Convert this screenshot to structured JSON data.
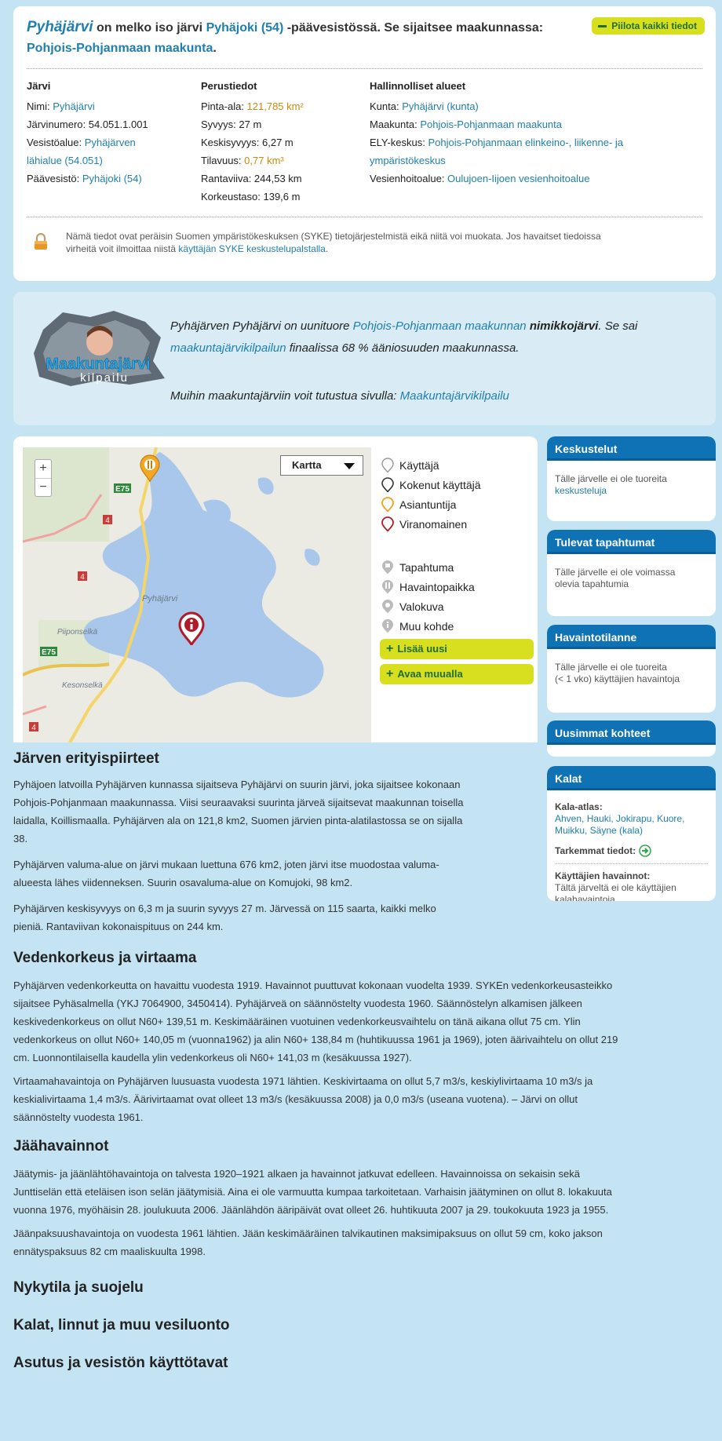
{
  "intro": {
    "lake_name": "Pyhäjärvi",
    "t1": "on melko iso järvi",
    "watershed_link": "Pyhäjoki (54)",
    "t2": "-päävesistössä. Se sijaitsee maakunnassa:",
    "region_link": "Pohjois-Pohjanmaan maakunta",
    "t3": ".",
    "hide_all_label": "Piilota kaikki tiedot"
  },
  "info": {
    "col1": {
      "title": "Järvi",
      "name_label": "Nimi:",
      "name_value": "Pyhäjärvi",
      "number_text": "Järvinumero: 54.051.1.001",
      "area_label": "Vesistöalue:",
      "area_value_1": "Pyhäjärven",
      "area_value_2": "lähialue (54.051)",
      "main_label": "Päävesistö:",
      "main_value": "Pyhäjoki (54)"
    },
    "col2": {
      "title": "Perustiedot",
      "area_label": "Pinta-ala:",
      "area_value": "121,785 km²",
      "depth_text": "Syvyys: 27 m",
      "avgdepth_text": "Keskisyvyys: 6,27 m",
      "volume_label": "Tilavuus:",
      "volume_value": "0,77 km³",
      "shore_text": "Rantaviiva: 244,53 km",
      "height_text": "Korkeustaso: 139,6 m"
    },
    "col3": {
      "title": "Hallinnolliset alueet",
      "kunta_label": "Kunta:",
      "kunta_value": "Pyhäjärvi (kunta)",
      "maakunta_label": "Maakunta:",
      "maakunta_value": "Pohjois-Pohjanmaan maakunta",
      "ely_label": "ELY-keskus:",
      "ely_value_1": "Pohjois-Pohjanmaan elinkeino-, liikenne- ja",
      "ely_value_2": "ympäristökeskus",
      "vh_label": "Vesienhoitoalue:",
      "vh_value": "Oulujoen-Iijoen vesienhoitoalue"
    },
    "notice_1": "Nämä tiedot ovat peräisin Suomen ympäristökeskuksen (SYKE) tietojärjestelmistä eikä niitä voi muokata. Jos havaitset tiedoissa",
    "notice_2": "virheitä voit ilmoittaa niistä",
    "notice_link": "käyttäjän SYKE keskustelupalstalla",
    "notice_end": "."
  },
  "maakunta": {
    "logo_text_1": "Maakuntajärvi",
    "logo_text_2": "kilpailu",
    "t1": "Pyhäjärven Pyhäjärvi on uunituore",
    "region_link": "Pohjois-Pohjanmaan maakunnan",
    "bold": "nimikkojärvi",
    "t2": ". Se sai",
    "contest_link": "maakuntajärvikilpailun",
    "t3": "finaalissa 68 % ääniosuuden maakunnassa.",
    "t4": "Muihin maakuntajärviin voit tutustua sivulla:",
    "page_link": "Maakuntajärvikilpailu"
  },
  "map": {
    "type_label": "Kartta",
    "zoom_in": "+",
    "zoom_out": "−",
    "labels": {
      "lake": "Pyhäjärvi",
      "place1": "Piiponselkä",
      "place2": "Kesonselkä",
      "e75a": "E75",
      "e75b": "E75",
      "r4a": "4",
      "r4b": "4",
      "r4c": "4"
    },
    "colors": {
      "water": "#a8c6ea",
      "land": "#eaeae2"
    },
    "legend": [
      "Käyttäjä",
      "Kokenut käyttäjä",
      "Asiantuntija",
      "Viranomainen"
    ],
    "legend2": [
      "Tapahtuma",
      "Havaintopaikka",
      "Valokuva",
      "Muu kohde"
    ],
    "add_new": "Lisää uusi",
    "open_elsewhere": "Avaa muualla"
  },
  "sidebar": {
    "keskustelut": {
      "title": "Keskustelut",
      "text": "Tälle järvelle ei ole tuoreita",
      "link": "keskusteluja"
    },
    "tapahtumat": {
      "title": "Tulevat tapahtumat",
      "text1": "Tälle järvelle ei ole voimassa",
      "text2": "olevia tapahtumia"
    },
    "havainto": {
      "title": "Havaintotilanne",
      "text1": "Tälle järvelle ei ole tuoreita",
      "text2": "(< 1 vko) käyttäjien havaintoja"
    },
    "uusimmat": {
      "title": "Uusimmat kohteet"
    },
    "kalat": {
      "title": "Kalat",
      "atlas_label": "Kala-atlas:",
      "fish_1": "Ahven, Hauki, Jokirapu, Kuore,",
      "fish_2": "Muikku, Säyne (kala)",
      "more_label": "Tarkemmat tiedot:",
      "obs_label": "Käyttäjien havainnot:",
      "obs_1": "Tältä järveltä ei ole käyttäjien",
      "obs_2": "kalahavaintoja"
    }
  },
  "sections": {
    "h1": "Järven erityispiirteet",
    "p1a": "Pyhäjoen latvoilla Pyhäjärven kunnassa sijaitseva Pyhäjärvi on suurin järvi, joka sijaitsee kokonaan",
    "p1b": "Pohjois-Pohjanmaan maakunnassa. Viisi seuraavaksi suurinta järveä sijaitsevat maakunnan toisella",
    "p1c": "laidalla, Koillismaalla. Pyhäjärven ala on 121,8 km2, Suomen järvien pinta-alatilastossa se on sijalla",
    "p1d": "38.",
    "p2a": "Pyhäjärven valuma-alue on järvi mukaan luettuna 676 km2, joten järvi itse muodostaa valuma-",
    "p2b": "alueesta lähes viidenneksen. Suurin osavaluma-alue on Komujoki, 98 km2.",
    "p3a": "Pyhäjärven keskisyvyys on 6,3 m ja suurin syvyys 27 m. Järvessä on 115 saarta, kaikki melko",
    "p3b": "pieniä. Rantaviivan kokonaispituus on 244 km.",
    "h2": "Vedenkorkeus ja virtaama",
    "p4a": "Pyhäjärven vedenkorkeutta on havaittu vuodesta 1919. Havainnot puuttuvat kokonaan vuodelta 1939. SYKEn vedenkorkeusasteikko",
    "p4b": "sijaitsee Pyhäsalmella (YKJ 7064900, 3450414). Pyhäjärveä on säännöstelty vuodesta 1960. Säännöstelyn alkamisen jälkeen",
    "p4c": "keskivedenkorkeus on ollut N60+ 139,51 m. Keskimääräinen vuotuinen vedenkorkeusvaihtelu on tänä aikana ollut 75 cm. Ylin",
    "p4d": "vedenkorkeus on ollut N60+ 140,05 m (vuonna1962) ja alin N60+ 138,84 m (huhtikuussa 1961 ja 1969), joten äärivaihtelu on ollut 219",
    "p4e": "cm. Luonnontilaisella kaudella ylin vedenkorkeus oli N60+ 141,03 m (kesäkuussa 1927).",
    "p5a": "Virtaamahavaintoja on Pyhäjärven luusuasta vuodesta 1971 lähtien. Keskivirtaama on ollut 5,7 m3/s, keskiylivirtaama 10 m3/s ja",
    "p5b": "keskialivirtaama 1,4 m3/s. Äärivirtaamat ovat olleet 13 m3/s (kesäkuussa 2008) ja 0,0 m3/s (useana vuotena). – Järvi on ollut",
    "p5c": "säännöstelty vuodesta 1961.",
    "h3": "Jäähavainnot",
    "p6a": "Jäätymis- ja jäänlähtöhavaintoja on talvesta 1920–1921 alkaen ja havainnot jatkuvat edelleen. Havainnoissa on sekaisin sekä",
    "p6b": "Junttiselän että eteläisen ison selän jäätymisiä. Aina ei ole varmuutta kumpaa tarkoitetaan. Varhaisin jäätyminen on ollut 8. lokakuuta",
    "p6c": "vuonna 1976, myöhäisin 28. joulukuuta 2006. Jäänlähdön ääripäivät ovat olleet 26. huhtikuuta 2007 ja 29. toukokuuta 1923 ja 1955.",
    "p7a": "Jäänpaksuushavaintoja on vuodesta 1961 lähtien. Jään keskimääräinen talvikautinen maksimipaksuus on ollut 59 cm, koko jakson",
    "p7b": "ennätyspaksuus 82 cm maaliskuulta 1998.",
    "h4": "Nykytila ja suojelu",
    "h5": "Kalat, linnut ja muu vesiluonto",
    "h6": "Asutus ja vesistön käyttötavat"
  }
}
